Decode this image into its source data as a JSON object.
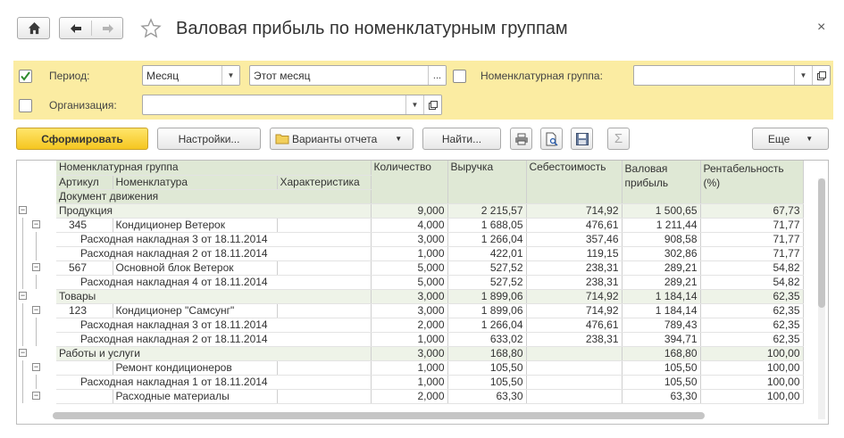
{
  "header": {
    "title": "Валовая прибыль по номенклатурным группам"
  },
  "filters": {
    "period_label": "Период:",
    "period_type": "Месяц",
    "period_value": "Этот месяц",
    "period_checked": true,
    "nomgroup_label": "Номенклатурная группа:",
    "nomgroup_value": "",
    "org_label": "Организация:",
    "org_value": ""
  },
  "toolbar": {
    "generate": "Сформировать",
    "settings": "Настройки...",
    "variants": "Варианты отчета",
    "find": "Найти...",
    "more": "Еще"
  },
  "table": {
    "headers": {
      "nomgroup": "Номенклатурная группа",
      "article": "Артикул",
      "nomenclature": "Номенклатура",
      "characteristic": "Характеристика",
      "document": "Документ движения",
      "quantity": "Количество",
      "revenue": "Выручка",
      "cost": "Себестоимость",
      "gross_profit": "Валовая прибыль",
      "profitability": "Рентабельность (%)"
    },
    "rows": [
      {
        "level": 0,
        "art": "",
        "name": "Продукция",
        "q": "9,000",
        "rev": "2 215,57",
        "cost": "714,92",
        "gp": "1 500,65",
        "pr": "67,73"
      },
      {
        "level": 1,
        "art": "345",
        "name": "Кондиционер Ветерок",
        "q": "4,000",
        "rev": "1 688,05",
        "cost": "476,61",
        "gp": "1 211,44",
        "pr": "71,77"
      },
      {
        "level": 2,
        "art": "",
        "name": "Расходная накладная 3 от 18.11.2014",
        "q": "3,000",
        "rev": "1 266,04",
        "cost": "357,46",
        "gp": "908,58",
        "pr": "71,77"
      },
      {
        "level": 2,
        "art": "",
        "name": "Расходная накладная 2 от 18.11.2014",
        "q": "1,000",
        "rev": "422,01",
        "cost": "119,15",
        "gp": "302,86",
        "pr": "71,77"
      },
      {
        "level": 1,
        "art": "567",
        "name": "Основной блок Ветерок",
        "q": "5,000",
        "rev": "527,52",
        "cost": "238,31",
        "gp": "289,21",
        "pr": "54,82"
      },
      {
        "level": 2,
        "art": "",
        "name": "Расходная накладная 4 от 18.11.2014",
        "q": "5,000",
        "rev": "527,52",
        "cost": "238,31",
        "gp": "289,21",
        "pr": "54,82"
      },
      {
        "level": 0,
        "art": "",
        "name": "Товары",
        "q": "3,000",
        "rev": "1 899,06",
        "cost": "714,92",
        "gp": "1 184,14",
        "pr": "62,35"
      },
      {
        "level": 1,
        "art": "123",
        "name": "Кондиционер \"Самсунг\"",
        "q": "3,000",
        "rev": "1 899,06",
        "cost": "714,92",
        "gp": "1 184,14",
        "pr": "62,35"
      },
      {
        "level": 2,
        "art": "",
        "name": "Расходная накладная 3 от 18.11.2014",
        "q": "2,000",
        "rev": "1 266,04",
        "cost": "476,61",
        "gp": "789,43",
        "pr": "62,35"
      },
      {
        "level": 2,
        "art": "",
        "name": "Расходная накладная 2 от 18.11.2014",
        "q": "1,000",
        "rev": "633,02",
        "cost": "238,31",
        "gp": "394,71",
        "pr": "62,35"
      },
      {
        "level": 0,
        "art": "",
        "name": "Работы и услуги",
        "q": "3,000",
        "rev": "168,80",
        "cost": "",
        "gp": "168,80",
        "pr": "100,00"
      },
      {
        "level": 1,
        "art": "",
        "name": "Ремонт кондиционеров",
        "q": "1,000",
        "rev": "105,50",
        "cost": "",
        "gp": "105,50",
        "pr": "100,00"
      },
      {
        "level": 2,
        "art": "",
        "name": "Расходная накладная 1 от 18.11.2014",
        "q": "1,000",
        "rev": "105,50",
        "cost": "",
        "gp": "105,50",
        "pr": "100,00"
      },
      {
        "level": 1,
        "art": "",
        "name": "Расходные материалы",
        "q": "2,000",
        "rev": "63,30",
        "cost": "",
        "gp": "63,30",
        "pr": "100,00"
      }
    ]
  },
  "colors": {
    "accent": "#f5c620",
    "filter_bg": "#fbeca2",
    "header_bg": "#dfe8d5",
    "group_bg": "#eef3e8"
  }
}
